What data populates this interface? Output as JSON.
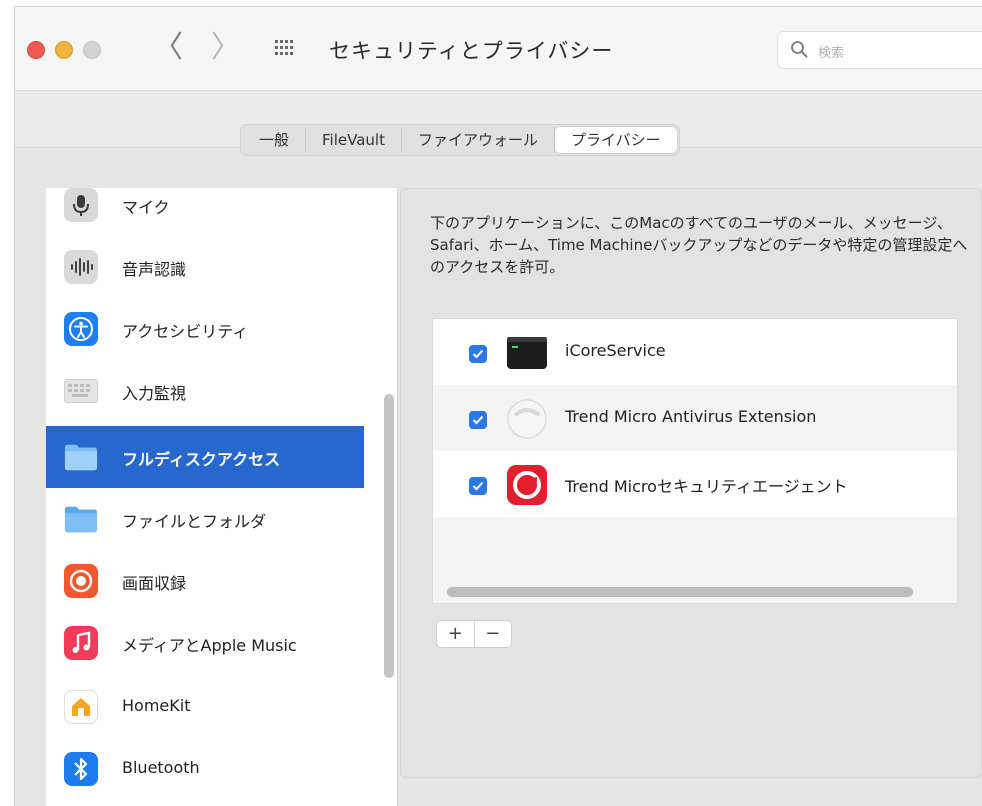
{
  "window": {
    "title": "セキュリティとプライバシー"
  },
  "toolbar": {
    "back_label": "〈",
    "forward_label": "〉"
  },
  "search": {
    "placeholder": "検索"
  },
  "tabs": [
    {
      "label": "一般"
    },
    {
      "label": "FileVault"
    },
    {
      "label": "ファイアウォール"
    },
    {
      "label": "プライバシー"
    }
  ],
  "sidebar": {
    "items": [
      {
        "label": "マイク",
        "icon": "microphone-icon"
      },
      {
        "label": "音声認識",
        "icon": "speech-recognition-icon"
      },
      {
        "label": "アクセシビリティ",
        "icon": "accessibility-icon"
      },
      {
        "label": "入力監視",
        "icon": "keyboard-icon"
      },
      {
        "label": "フルディスクアクセス",
        "icon": "folder-icon"
      },
      {
        "label": "ファイルとフォルダ",
        "icon": "folder-icon"
      },
      {
        "label": "画面収録",
        "icon": "screen-recording-icon"
      },
      {
        "label": "メディアとApple Music",
        "icon": "music-icon"
      },
      {
        "label": "HomeKit",
        "icon": "home-icon"
      },
      {
        "label": "Bluetooth",
        "icon": "bluetooth-icon"
      }
    ],
    "selected": "フルディスクアクセス"
  },
  "main": {
    "description": "下のアプリケーションに、このMacのすべてのユーザのメール、メッセージ、Safari、ホーム、Time Machineバックアップなどのデータや特定の管理設定へのアクセスを許可。",
    "apps": [
      {
        "name": "iCoreService",
        "checked": true,
        "icon": "terminal-icon"
      },
      {
        "name": "Trend Micro Antivirus Extension",
        "checked": true,
        "icon": "shield-icon"
      },
      {
        "name": "Trend Microセキュリティエージェント",
        "checked": true,
        "icon": "trend-micro-icon"
      }
    ],
    "add_label": "+",
    "remove_label": "−"
  },
  "colors": {
    "selection": "#2867cd",
    "checkbox": "#2b78e4",
    "close": "#ee5b52",
    "minimize": "#f2b43c"
  }
}
